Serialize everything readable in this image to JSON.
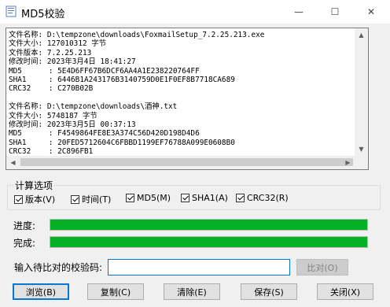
{
  "window": {
    "title": "MD5校验",
    "controls": {
      "minimize": "—",
      "maximize": "☐",
      "close": "✕"
    }
  },
  "log": {
    "entries": [
      {
        "name_label": "文件名称:",
        "name": "D:\\tempzone\\downloads\\FoxmailSetup_7.2.25.213.exe",
        "size_label": "文件大小:",
        "size": "127010312 字节",
        "version_label": "文件版本:",
        "version": "7.2.25.213",
        "mtime_label": "修改时间:",
        "mtime": "2023年3月4日 18:41:27",
        "md5_label": "MD5",
        "md5": "5E4D6FF67B6DCF6AA4A1E238220764FF",
        "sha1_label": "SHA1",
        "sha1": "6446B1A243176B3140759D0E1F0EF8B7718CA689",
        "crc32_label": "CRC32",
        "crc32": "C270B02B"
      },
      {
        "name_label": "文件名称:",
        "name": "D:\\tempzone\\downloads\\酒神.txt",
        "size_label": "文件大小:",
        "size": "5748187 字节",
        "mtime_label": "修改时间:",
        "mtime": "2023年3月5日 00:37:13",
        "md5_label": "MD5",
        "md5": "F4549864FE8E3A374C56D420D198D4D6",
        "sha1_label": "SHA1",
        "sha1": "20FED5712604C6FBBD1199EF76788A099E0608B0",
        "crc32_label": "CRC32",
        "crc32": "2C896FB1"
      }
    ]
  },
  "options": {
    "group_label": "计算选项",
    "items": [
      {
        "label": "版本(V)",
        "checked": true
      },
      {
        "label": "时间(T)",
        "checked": true
      },
      {
        "label": "MD5(M)",
        "checked": true
      },
      {
        "label": "SHA1(A)",
        "checked": true
      },
      {
        "label": "CRC32(R)",
        "checked": true
      }
    ]
  },
  "progress": {
    "progress_label": "进度:",
    "progress_value": 1.0,
    "complete_label": "完成:",
    "complete_value": 1.0,
    "fill_color": "#06b025"
  },
  "compare": {
    "label": "输入待比对的校验码:",
    "value": "",
    "button": "比对(O)"
  },
  "buttons": {
    "browse": "浏览(B)",
    "copy": "复制(C)",
    "clear": "清除(E)",
    "save": "保存(S)",
    "close": "关闭(X)"
  }
}
